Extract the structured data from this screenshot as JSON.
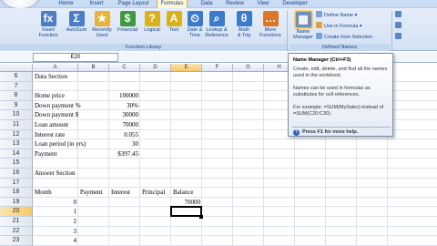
{
  "window": {
    "tabs": [
      "Home",
      "Insert",
      "Page Layout",
      "Formulas",
      "Data",
      "Review",
      "View",
      "Developer"
    ],
    "active_tab": "Formulas"
  },
  "ribbon": {
    "function_library": {
      "label": "Function Library",
      "buttons": [
        {
          "label": "Insert\nFunction",
          "icon": "fx-icon",
          "glyph": "fx",
          "color": "#4d7dc4"
        },
        {
          "label": "AutoSum",
          "icon": "sigma-icon",
          "glyph": "Σ",
          "color": "#4d7dc4"
        },
        {
          "label": "Recently\nUsed",
          "icon": "star-icon",
          "glyph": "★",
          "color": "#e8b33a"
        },
        {
          "label": "Financial",
          "icon": "book-green-icon",
          "glyph": "$",
          "color": "#3f9a3f"
        },
        {
          "label": "Logical",
          "icon": "book-yellow-icon",
          "glyph": "?",
          "color": "#d8b21c"
        },
        {
          "label": "Text",
          "icon": "book-a-icon",
          "glyph": "A",
          "color": "#d8b21c"
        },
        {
          "label": "Date &\nTime",
          "icon": "calendar-icon",
          "glyph": "⏲",
          "color": "#3c7bc9"
        },
        {
          "label": "Lookup &\nReference",
          "icon": "book-blue-icon",
          "glyph": "⌕",
          "color": "#3c7bc9"
        },
        {
          "label": "Math\n& Trig",
          "icon": "book-math-icon",
          "glyph": "θ",
          "color": "#3c7bc9"
        },
        {
          "label": "More\nFunctions",
          "icon": "book-orange-icon",
          "glyph": "…",
          "color": "#d9782a"
        }
      ]
    },
    "defined_names": {
      "label": "Defined Names",
      "name_manager_label": "Name\nManager",
      "commands": [
        "Define Name ▾",
        "Use in Formula ▾",
        "Create from Selection"
      ]
    }
  },
  "formula_bar": {
    "name_box": "E20"
  },
  "grid": {
    "columns": [
      "A",
      "B",
      "C",
      "D",
      "E",
      "F",
      "G",
      "H",
      "I",
      "J",
      "K"
    ],
    "rows": [
      {
        "n": "6",
        "cells": {
          "A": "Data Section"
        }
      },
      {
        "n": "7",
        "cells": {}
      },
      {
        "n": "8",
        "cells": {
          "A": "Home price",
          "C": "100000"
        }
      },
      {
        "n": "9",
        "cells": {
          "A": "Down payment %",
          "C": "30%"
        }
      },
      {
        "n": "10",
        "cells": {
          "A": "Down payment $",
          "C": "30000"
        }
      },
      {
        "n": "11",
        "cells": {
          "A": "Loan amount",
          "C": "70000"
        }
      },
      {
        "n": "12",
        "cells": {
          "A": "Interest rate",
          "C": "0.055"
        }
      },
      {
        "n": "13",
        "cells": {
          "A": "Loan period (in yrs)",
          "C": "30"
        }
      },
      {
        "n": "14",
        "cells": {
          "A": "Payment",
          "C": "$397.45"
        }
      },
      {
        "n": "15",
        "cells": {}
      },
      {
        "n": "16",
        "cells": {
          "A": "Answer Section"
        }
      },
      {
        "n": "17",
        "cells": {}
      },
      {
        "n": "18",
        "cells": {
          "A": "Month",
          "B": "Payment",
          "C": "Interest",
          "D": "Principal",
          "E": "Balance"
        }
      },
      {
        "n": "19",
        "cells": {
          "A": "0",
          "E": "70000"
        }
      },
      {
        "n": "20",
        "cells": {
          "A": "1"
        }
      },
      {
        "n": "21",
        "cells": {
          "A": "2"
        }
      },
      {
        "n": "22",
        "cells": {
          "A": "3"
        }
      },
      {
        "n": "23",
        "cells": {
          "A": "4"
        }
      }
    ],
    "active_cell": "E20"
  },
  "tooltip": {
    "title": "Name Manager (Ctrl+F3)",
    "line1": "Create, edit, delete, and find all the names used in the workbook.",
    "line2": "Names can be used in formulas as substitutes for cell references.",
    "line3": "For example: =SUM(MySales) instead of =SUM(C20:C30).",
    "help": "Press F1 for more help."
  }
}
